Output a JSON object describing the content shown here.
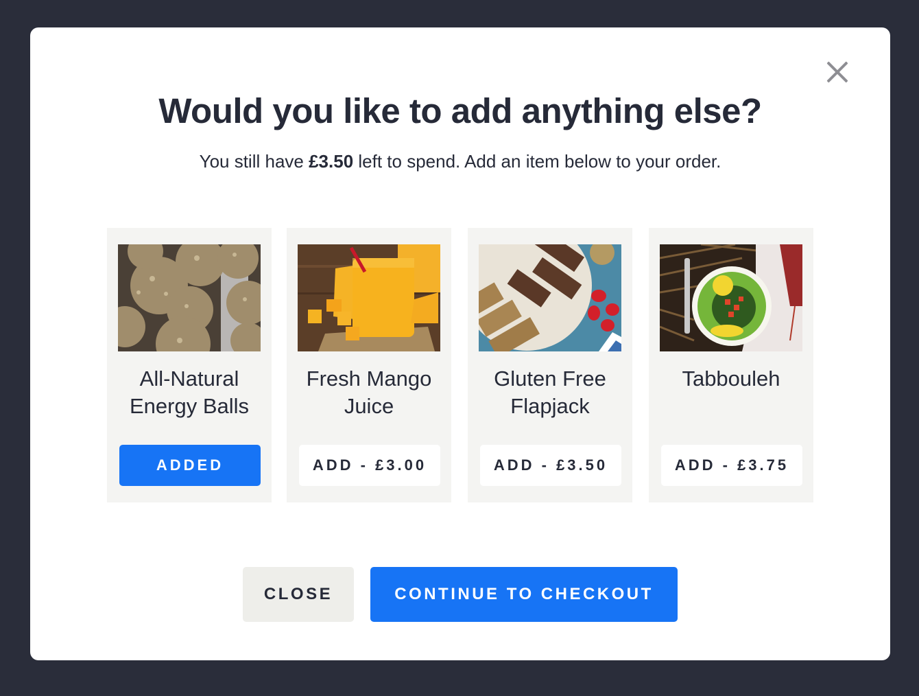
{
  "modal": {
    "title": "Would you like to add anything else?",
    "subtitle_prefix": "You still have ",
    "subtitle_amount": "£3.50",
    "subtitle_suffix": " left to spend. Add an item below to your order.",
    "close_icon": "close-x-icon"
  },
  "products": [
    {
      "name": "All-Natural Energy Balls",
      "image": "energy-balls-photo",
      "button_label": "ADDED",
      "added": true
    },
    {
      "name": "Fresh Mango Juice",
      "image": "mango-juice-photo",
      "button_label": "ADD - £3.00",
      "added": false
    },
    {
      "name": "Gluten Free Flapjack",
      "image": "flapjack-photo",
      "button_label": "ADD - £3.50",
      "added": false
    },
    {
      "name": "Tabbouleh",
      "image": "tabbouleh-photo",
      "button_label": "ADD - £3.75",
      "added": false
    }
  ],
  "footer": {
    "close_label": "CLOSE",
    "checkout_label": "CONTINUE TO CHECKOUT"
  },
  "colors": {
    "accent": "#1774f5",
    "backdrop": "#2a2d3a",
    "text": "#262a38",
    "card_bg": "#f4f4f2"
  }
}
